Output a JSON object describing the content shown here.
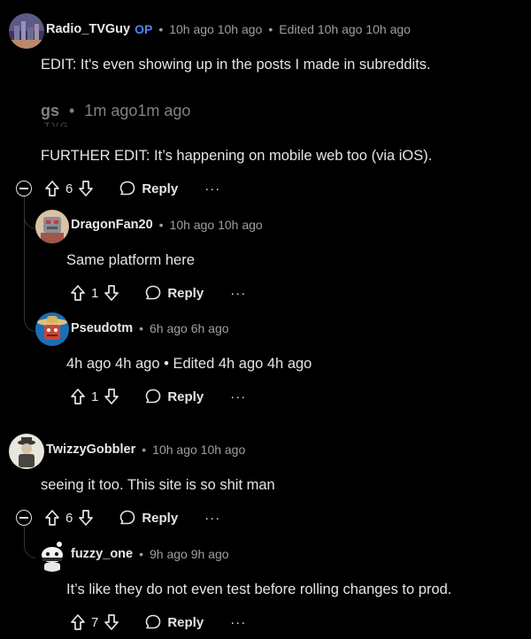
{
  "comments": [
    {
      "id": "c1",
      "username": "Radio_TVGuy",
      "op_badge": "OP",
      "time": "10h ago 10h ago",
      "edited": "Edited 10h ago 10h ago",
      "paragraphs": [
        "EDIT: It's even showing up in the posts I made in subreddits.",
        "FURTHER EDIT: It’s happening on mobile web too (via iOS)."
      ],
      "votes": "6",
      "reply_label": "Reply",
      "more": "···"
    },
    {
      "id": "c1r1",
      "username": "DragonFan20",
      "time": "10h ago 10h ago",
      "paragraphs": [
        "Same platform here"
      ],
      "votes": "1",
      "reply_label": "Reply",
      "more": "···"
    },
    {
      "id": "c1r2",
      "username": "Pseudotm",
      "time": "6h ago 6h ago",
      "paragraphs": [
        "4h ago 4h ago • Edited 4h ago 4h ago"
      ],
      "votes": "1",
      "reply_label": "Reply",
      "more": "···"
    },
    {
      "id": "c2",
      "username": "TwizzyGobbler",
      "time": "10h ago 10h ago",
      "paragraphs": [
        "seeing it too. This site is so shit man"
      ],
      "votes": "6",
      "reply_label": "Reply",
      "more": "···"
    },
    {
      "id": "c2r1",
      "username": "fuzzy_one",
      "time": "9h ago 9h ago",
      "paragraphs": [
        "It’s like they do not even test before rolling changes to prod."
      ],
      "votes": "7",
      "reply_label": "Reply",
      "more": "···"
    }
  ],
  "embedded_ghost": {
    "username": "gs",
    "time": "1m ago1m ago",
    "fragment": "TVG"
  },
  "meta": {
    "separator": "•"
  }
}
